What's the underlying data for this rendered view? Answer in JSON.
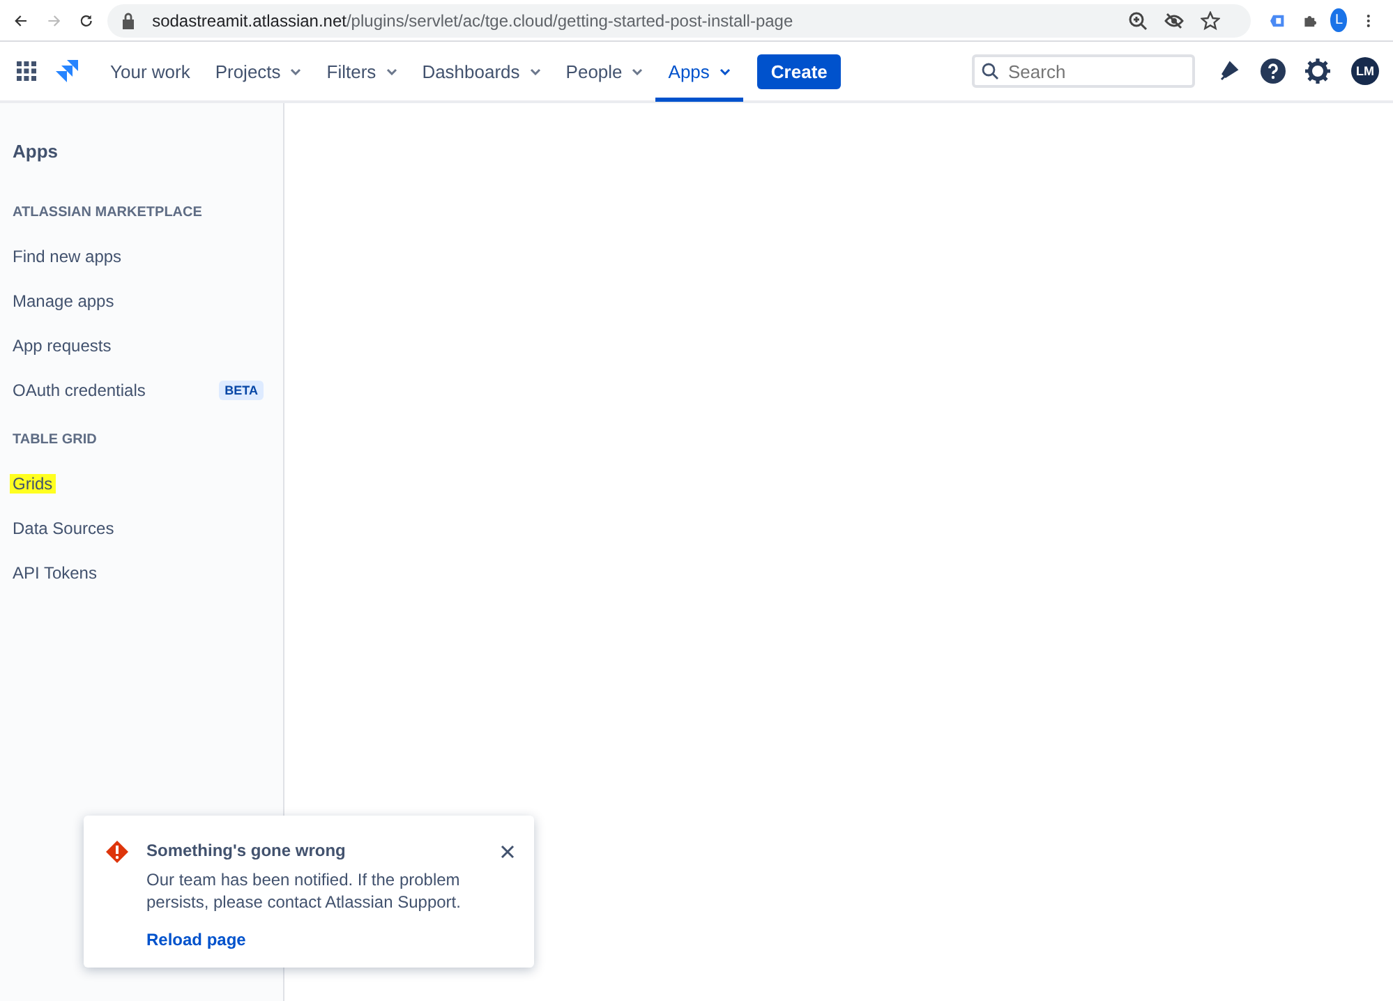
{
  "browser": {
    "url_host": "sodastreamit.atlassian.net",
    "url_path": "/plugins/servlet/ac/tge.cloud/getting-started-post-install-page",
    "profile_initial": "L"
  },
  "nav": {
    "items": [
      {
        "label": "Your work",
        "dropdown": false,
        "selected": false
      },
      {
        "label": "Projects",
        "dropdown": true,
        "selected": false
      },
      {
        "label": "Filters",
        "dropdown": true,
        "selected": false
      },
      {
        "label": "Dashboards",
        "dropdown": true,
        "selected": false
      },
      {
        "label": "People",
        "dropdown": true,
        "selected": false
      },
      {
        "label": "Apps",
        "dropdown": true,
        "selected": true
      }
    ],
    "create_button": "Create",
    "search": {
      "placeholder": "Search"
    },
    "avatar": "LM"
  },
  "sidebar": {
    "title": "Apps",
    "sections": [
      {
        "heading": "ATLASSIAN MARKETPLACE",
        "items": [
          {
            "label": "Find new apps",
            "highlighted": false
          },
          {
            "label": "Manage apps",
            "highlighted": false
          },
          {
            "label": "App requests",
            "highlighted": false
          },
          {
            "label": "OAuth credentials",
            "badge": "BETA",
            "highlighted": false
          }
        ]
      },
      {
        "heading": "TABLE GRID",
        "items": [
          {
            "label": "Grids",
            "highlighted": true
          },
          {
            "label": "Data Sources",
            "highlighted": false
          },
          {
            "label": "API Tokens",
            "highlighted": false
          }
        ]
      }
    ]
  },
  "flag": {
    "title": "Something's gone wrong",
    "message": "Our team has been notified. If the problem persists, please contact Atlassian Support.",
    "action": "Reload page"
  }
}
